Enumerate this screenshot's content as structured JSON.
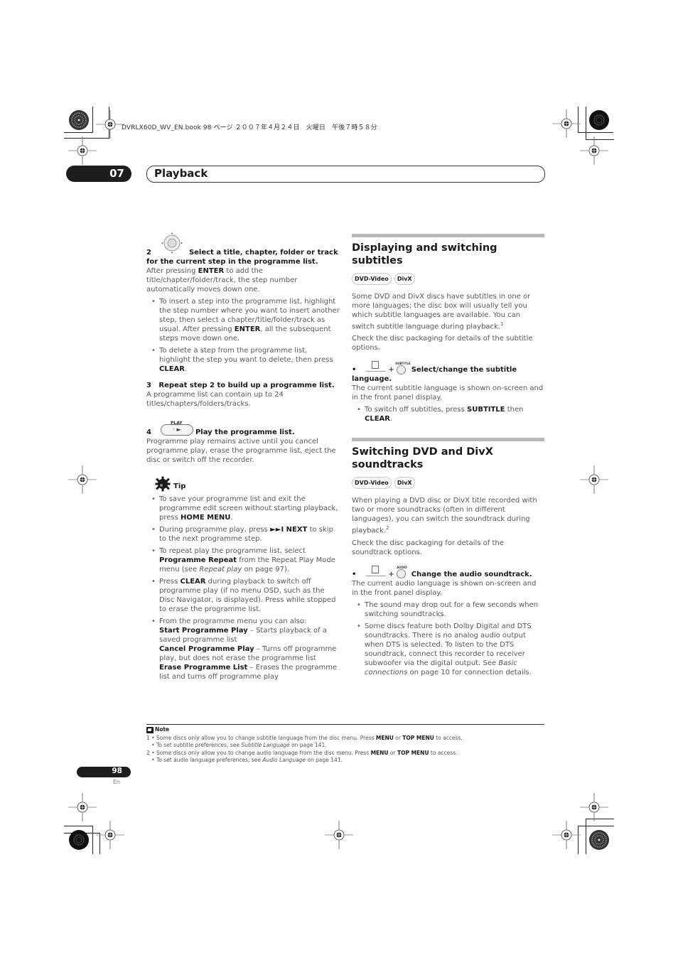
{
  "file_header": "DVRLX60D_WV_EN.book  98 ページ  ２００７年４月２４日　火曜日　午後７時５８分",
  "chapter": {
    "number": "07",
    "title": "Playback"
  },
  "left_column": {
    "step2": {
      "num": "2",
      "heading": "Select a title, chapter, folder or track for the current step in the programme list.",
      "body_pre": "After pressing ",
      "body_key": "ENTER",
      "body_post": " to add the title/chapter/folder/track, the step number automatically moves down one.",
      "bullets": [
        {
          "pre": "To insert a step into the programme list, highlight the step number where you want to insert another step, then select a chapter/title/folder/track as usual. After pressing ",
          "key": "ENTER",
          "post": ", all the subsequent steps move down one."
        },
        {
          "pre": "To delete a step from the programme list, highlight the step you want to delete, then press ",
          "key": "CLEAR",
          "post": "."
        }
      ]
    },
    "step3": {
      "num": "3",
      "heading": "Repeat step 2 to build up a programme list.",
      "body": "A programme list can contain up to 24 titles/chapters/folders/tracks."
    },
    "step4": {
      "num": "4",
      "button_label": "PLAY",
      "heading": "Play the programme list.",
      "body": "Programme play remains active until you cancel programme play, erase the programme list, eject the disc or switch off the recorder."
    },
    "tip": {
      "label": "Tip",
      "bullets": [
        {
          "pre": "To save your programme list and exit the programme edit screen without starting playback, press ",
          "key": "HOME MENU",
          "post": "."
        },
        {
          "pre": "During programme play, press ",
          "key": "►►I NEXT",
          "post": " to skip to the next programme step."
        },
        {
          "pre": "To repeat play the programme list, select ",
          "key": "Programme Repeat",
          "mid": " from the Repeat Play Mode menu (see ",
          "ital": "Repeat play",
          "post": " on page 97)."
        },
        {
          "pre": "Press ",
          "key": "CLEAR",
          "post": " during playback to switch off programme play (if no menu OSD, such as the Disc Navigator, is displayed). Press while stopped to erase the programme list."
        }
      ],
      "menu_intro": "From the programme menu you can also:",
      "menu_items": [
        {
          "name": "Start Programme Play",
          "desc": " – Starts playback of a saved programme list"
        },
        {
          "name": "Cancel Programme Play",
          "desc": " – Turns off programme play, but does not erase the programme list"
        },
        {
          "name": "Erase Programme List",
          "desc": " – Erases the programme list and turns off programme play"
        }
      ]
    }
  },
  "right_column": {
    "subtitles": {
      "title": "Displaying and switching subtitles",
      "badges": [
        "DVD-Video",
        "DivX"
      ],
      "para1": "Some DVD and DivX discs have subtitles in one or more languages; the disc box will usually tell you which subtitle languages are available. You can switch subtitle language during playback.",
      "para1_sup": "1",
      "para2": "Check the disc packaging for details of the subtitle options.",
      "button_label": "SUBTITLE",
      "action": "Select/change the subtitle language.",
      "body": "The current subtitle language is shown on-screen and in the front panel display.",
      "bullet": {
        "pre": "To switch off subtitles, press ",
        "key": "SUBTITLE",
        "mid": " then ",
        "key2": "CLEAR",
        "post": "."
      }
    },
    "soundtracks": {
      "title": "Switching DVD and DivX soundtracks",
      "badges": [
        "DVD-Video",
        "DivX"
      ],
      "para1": "When playing a DVD disc or DivX title recorded with two or more soundtracks (often in different languages), you can switch the soundtrack during playback.",
      "para1_sup": "2",
      "para2": "Check the disc packaging for details of the soundtrack options.",
      "button_label": "AUDIO",
      "action": "Change the audio soundtrack.",
      "body": "The current audio language is shown on-screen and in the front panel display.",
      "bullets": [
        {
          "pre": "The sound may drop out for a few seconds when switching soundtracks."
        },
        {
          "pre": "Some discs feature both Dolby Digital and DTS soundtracks. There is no analog audio output when DTS is selected. To listen to the DTS soundtrack, connect this recorder to receiver subwoofer via the digital output. See ",
          "ital": "Basic connections",
          "post": " on page 10 for connection details."
        }
      ]
    }
  },
  "note": {
    "label": "Note",
    "items": [
      {
        "num": "1",
        "line1_pre": "• Some discs only allow you to change subtitle language from the disc menu. Press ",
        "k1": "MENU",
        "or": " or ",
        "k2": "TOP MENU",
        "line1_post": " to access.",
        "line2_pre": "• To set subtitle preferences, see ",
        "line2_ital": "Subtitle Language",
        "line2_post": " on page 141."
      },
      {
        "num": "2",
        "line1_pre": "• Some discs only allow you to change audio language from the disc menu. Press ",
        "k1": "MENU",
        "or": " or ",
        "k2": "TOP MENU",
        "line1_post": " to access.",
        "line2_pre": "• To set audio language preferences, see ",
        "line2_ital": "Audio Language",
        "line2_post": " on page 141."
      }
    ]
  },
  "footer": {
    "page_number": "98",
    "language": "En"
  }
}
